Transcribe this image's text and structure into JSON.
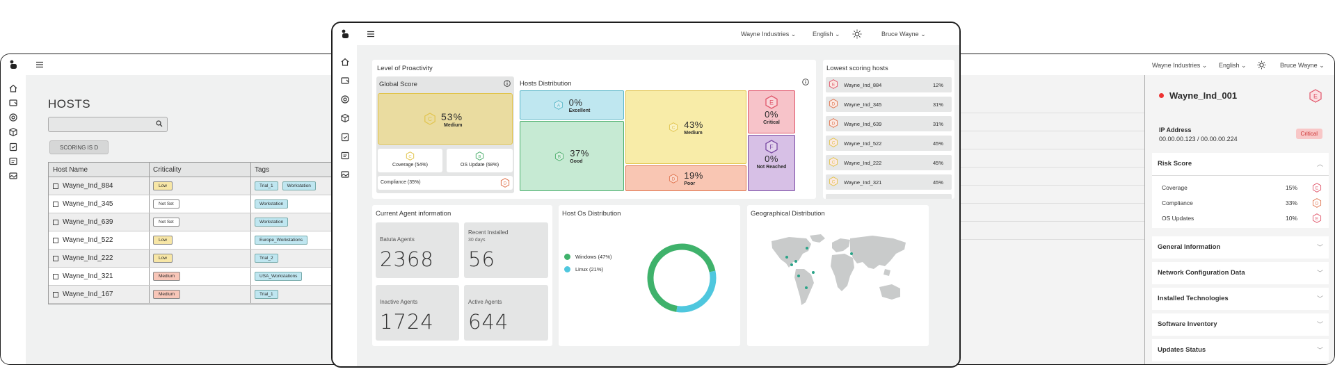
{
  "left_window": {
    "title": "HOSTS",
    "search_placeholder": "",
    "scoring_chip": "SCORING IS D",
    "columns": [
      "Host Name",
      "Criticality",
      "Tags"
    ],
    "rows": [
      {
        "name": "Wayne_Ind_884",
        "criticality": "Low",
        "crit_color": "#f7e6a6",
        "tags": [
          "Trial_1",
          "Workstation"
        ]
      },
      {
        "name": "Wayne_Ind_345",
        "criticality": "Not Set",
        "crit_color": "#ffffff",
        "tags": [
          "Workstation"
        ]
      },
      {
        "name": "Wayne_Ind_639",
        "criticality": "Not Set",
        "crit_color": "#ffffff",
        "tags": [
          "Workstation"
        ]
      },
      {
        "name": "Wayne_Ind_522",
        "criticality": "Low",
        "crit_color": "#f7e6a6",
        "tags": [
          "Europe_Workstations"
        ]
      },
      {
        "name": "Wayne_Ind_222",
        "criticality": "Low",
        "crit_color": "#f7e6a6",
        "tags": [
          "Trial_2"
        ]
      },
      {
        "name": "Wayne_Ind_321",
        "criticality": "Medium",
        "crit_color": "#f8c6b8",
        "tags": [
          "USA_Workstations"
        ]
      },
      {
        "name": "Wayne_Ind_167",
        "criticality": "Medium",
        "crit_color": "#f8c6b8",
        "tags": [
          "Trial_1"
        ]
      }
    ]
  },
  "center_window": {
    "topbar": {
      "org": "Wayne Industries",
      "language": "English",
      "user": "Bruce Wayne"
    },
    "proactivity": {
      "title": "Level of Proactivity",
      "global_score": {
        "title": "Global Score",
        "value": "53%",
        "label": "Medium",
        "grade": "C"
      },
      "coverage": {
        "label": "Coverage (54%)",
        "grade": "C"
      },
      "os_update": {
        "label": "OS Update (68%)",
        "grade": "B"
      },
      "compliance": {
        "label": "Compliance (35%)",
        "grade": "D"
      }
    },
    "hosts_distribution": {
      "title": "Hosts Distribution",
      "tiles": [
        {
          "grade": "A",
          "value": "0%",
          "label": "Excellent",
          "color": "#bfe7f0",
          "stroke": "#5bb7c9"
        },
        {
          "grade": "B",
          "value": "37%",
          "label": "Good",
          "color": "#c6ead3",
          "stroke": "#4cae6c"
        },
        {
          "grade": "C",
          "value": "43%",
          "label": "Medium",
          "color": "#f8eca8",
          "stroke": "#e1c34a"
        },
        {
          "grade": "D",
          "value": "19%",
          "label": "Poor",
          "color": "#f9c6b3",
          "stroke": "#e0744f"
        },
        {
          "grade": "E",
          "value": "0%",
          "label": "Critical",
          "color": "#f7c3c9",
          "stroke": "#e0556a"
        },
        {
          "grade": "F",
          "value": "0%",
          "label": "Not Reached",
          "color": "#d7c0e6",
          "stroke": "#7a4aa3"
        }
      ]
    },
    "lowest_scoring": {
      "title": "Lowest scoring hosts",
      "rows": [
        {
          "grade": "E",
          "name": "Wayne_Ind_884",
          "pct": "12%",
          "color": "#e0556a"
        },
        {
          "grade": "D",
          "name": "Wayne_Ind_345",
          "pct": "31%",
          "color": "#e0744f"
        },
        {
          "grade": "D",
          "name": "Wayne_Ind_639",
          "pct": "31%",
          "color": "#e0744f"
        },
        {
          "grade": "C",
          "name": "Wayne_Ind_522",
          "pct": "45%",
          "color": "#e1c34a"
        },
        {
          "grade": "C",
          "name": "Wayne_Ind_222",
          "pct": "45%",
          "color": "#e1c34a"
        },
        {
          "grade": "C",
          "name": "Wayne_Ind_321",
          "pct": "45%",
          "color": "#e1c34a"
        }
      ]
    },
    "agents": {
      "title": "Current Agent information",
      "batuta": {
        "label": "Batuta Agents",
        "value": "2368"
      },
      "recent": {
        "label": "Recent Installed",
        "sub": "30 days",
        "value": "56"
      },
      "inactive": {
        "label": "Inactive Agents",
        "value": "1724"
      },
      "active": {
        "label": "Active Agents",
        "value": "644"
      }
    },
    "os_distribution": {
      "title": "Host Os Distribution",
      "legend": [
        {
          "label": "Windows (47%)",
          "color": "#3fb26b"
        },
        {
          "label": "Linux (21%)",
          "color": "#4fc7de"
        }
      ],
      "chart_data": {
        "type": "pie",
        "categories": [
          "Windows",
          "Linux"
        ],
        "values": [
          47,
          21
        ],
        "colors": [
          "#3fb26b",
          "#4fc7de"
        ]
      }
    },
    "geo": {
      "title": "Geographical Distribution"
    }
  },
  "right_window": {
    "topbar": {
      "org": "Wayne Industries",
      "language": "English",
      "user": "Bruce Wayne"
    },
    "host_name": "Wayne_Ind_001",
    "host_grade": "E",
    "ip_label": "IP Address",
    "ip_value": "00.00.00.123  / 00.00.00.224",
    "criticality": "Critical",
    "risk_score": {
      "title": "Risk Score",
      "rows": [
        {
          "label": "Coverage",
          "pct": "15%",
          "grade": "E",
          "color": "#e0556a"
        },
        {
          "label": "Compliance",
          "pct": "33%",
          "grade": "D",
          "color": "#e0744f"
        },
        {
          "label": "OS Updates",
          "pct": "10%",
          "grade": "E",
          "color": "#e0556a"
        }
      ]
    },
    "sections": [
      "General Information",
      "Network Configuration Data",
      "Installed Technologies",
      "Software Inventory",
      "Updates Status"
    ]
  }
}
